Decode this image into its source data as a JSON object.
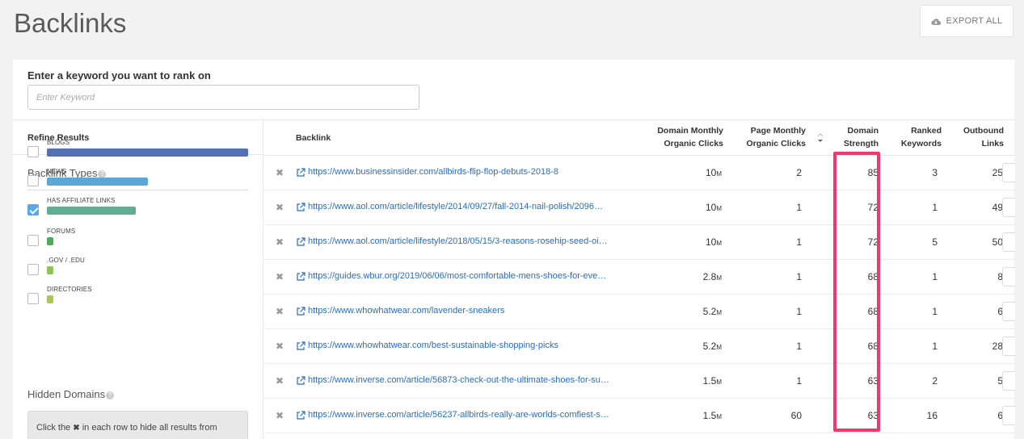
{
  "header": {
    "title": "Backlinks",
    "export_label": "EXPORT ALL"
  },
  "keyword": {
    "label": "Enter a keyword you want to rank on",
    "placeholder": "Enter Keyword",
    "value": ""
  },
  "sidebar": {
    "refine_label": "Refine Results",
    "backlink_types_title": "Backlink Types",
    "types": [
      {
        "label": "BLOGS",
        "checked": false,
        "color": "#5470b4",
        "share": 1.0
      },
      {
        "label": "NEWS",
        "checked": false,
        "color": "#5aa8d6",
        "share": 0.5
      },
      {
        "label": "HAS AFFILIATE LINKS",
        "checked": true,
        "color": "#5fae94",
        "share": 0.44
      },
      {
        "label": "FORUMS",
        "checked": false,
        "color": "#4caa5a",
        "share": 0.03
      },
      {
        "label": ".GOV / .EDU",
        "checked": false,
        "color": "#8dc452",
        "share": 0.03
      },
      {
        "label": "DIRECTORIES",
        "checked": false,
        "color": "#a8c85a",
        "share": 0.03
      }
    ],
    "hidden_domains_title": "Hidden Domains",
    "hidden_hint_pre": "Click the",
    "hidden_hint_icon": "✖",
    "hidden_hint_post": "in each row to hide all results from"
  },
  "table": {
    "columns": {
      "backlink": "Backlink",
      "domain_clicks_1": "Domain Monthly",
      "domain_clicks_2": "Organic Clicks",
      "page_clicks_1": "Page Monthly",
      "page_clicks_2": "Organic Clicks",
      "strength_1": "Domain",
      "strength_2": "Strength",
      "ranked_1": "Ranked",
      "ranked_2": "Keywords",
      "outbound_1": "Outbound",
      "outbound_2": "Links"
    },
    "rows": [
      {
        "url": "https://www.businessinsider.com/allbirds-flip-flop-debuts-2018-8",
        "domain_clicks": "10",
        "domain_unit": "M",
        "page_clicks": "2",
        "strength": "85",
        "ranked": "3",
        "outbound": "25"
      },
      {
        "url": "https://www.aol.com/article/lifestyle/2014/09/27/fall-2014-nail-polish/2096…",
        "domain_clicks": "10",
        "domain_unit": "M",
        "page_clicks": "1",
        "strength": "72",
        "ranked": "1",
        "outbound": "49"
      },
      {
        "url": "https://www.aol.com/article/lifestyle/2018/05/15/3-reasons-rosehip-seed-oi…",
        "domain_clicks": "10",
        "domain_unit": "M",
        "page_clicks": "1",
        "strength": "72",
        "ranked": "5",
        "outbound": "50"
      },
      {
        "url": "https://guides.wbur.org/2019/06/06/most-comfortable-mens-shoes-for-eve…",
        "domain_clicks": "2.8",
        "domain_unit": "M",
        "page_clicks": "1",
        "strength": "68",
        "ranked": "1",
        "outbound": "8"
      },
      {
        "url": "https://www.whowhatwear.com/lavender-sneakers",
        "domain_clicks": "5.2",
        "domain_unit": "M",
        "page_clicks": "1",
        "strength": "68",
        "ranked": "1",
        "outbound": "6"
      },
      {
        "url": "https://www.whowhatwear.com/best-sustainable-shopping-picks",
        "domain_clicks": "5.2",
        "domain_unit": "M",
        "page_clicks": "1",
        "strength": "68",
        "ranked": "1",
        "outbound": "28"
      },
      {
        "url": "https://www.inverse.com/article/56873-check-out-the-ultimate-shoes-for-su…",
        "domain_clicks": "1.5",
        "domain_unit": "M",
        "page_clicks": "1",
        "strength": "63",
        "ranked": "2",
        "outbound": "5"
      },
      {
        "url": "https://www.inverse.com/article/56237-allbirds-really-are-worlds-comfiest-s…",
        "domain_clicks": "1.5",
        "domain_unit": "M",
        "page_clicks": "60",
        "strength": "63",
        "ranked": "16",
        "outbound": "6"
      }
    ]
  },
  "icons": {
    "remove": "close-icon",
    "external": "external-link-icon",
    "export": "cloud-download-icon",
    "help": "help-icon",
    "sort": "sort-icon"
  },
  "colors": {
    "link": "#2a6ebb",
    "highlight": "#f2376e",
    "checkbox_checked": "#5aa7e8"
  }
}
